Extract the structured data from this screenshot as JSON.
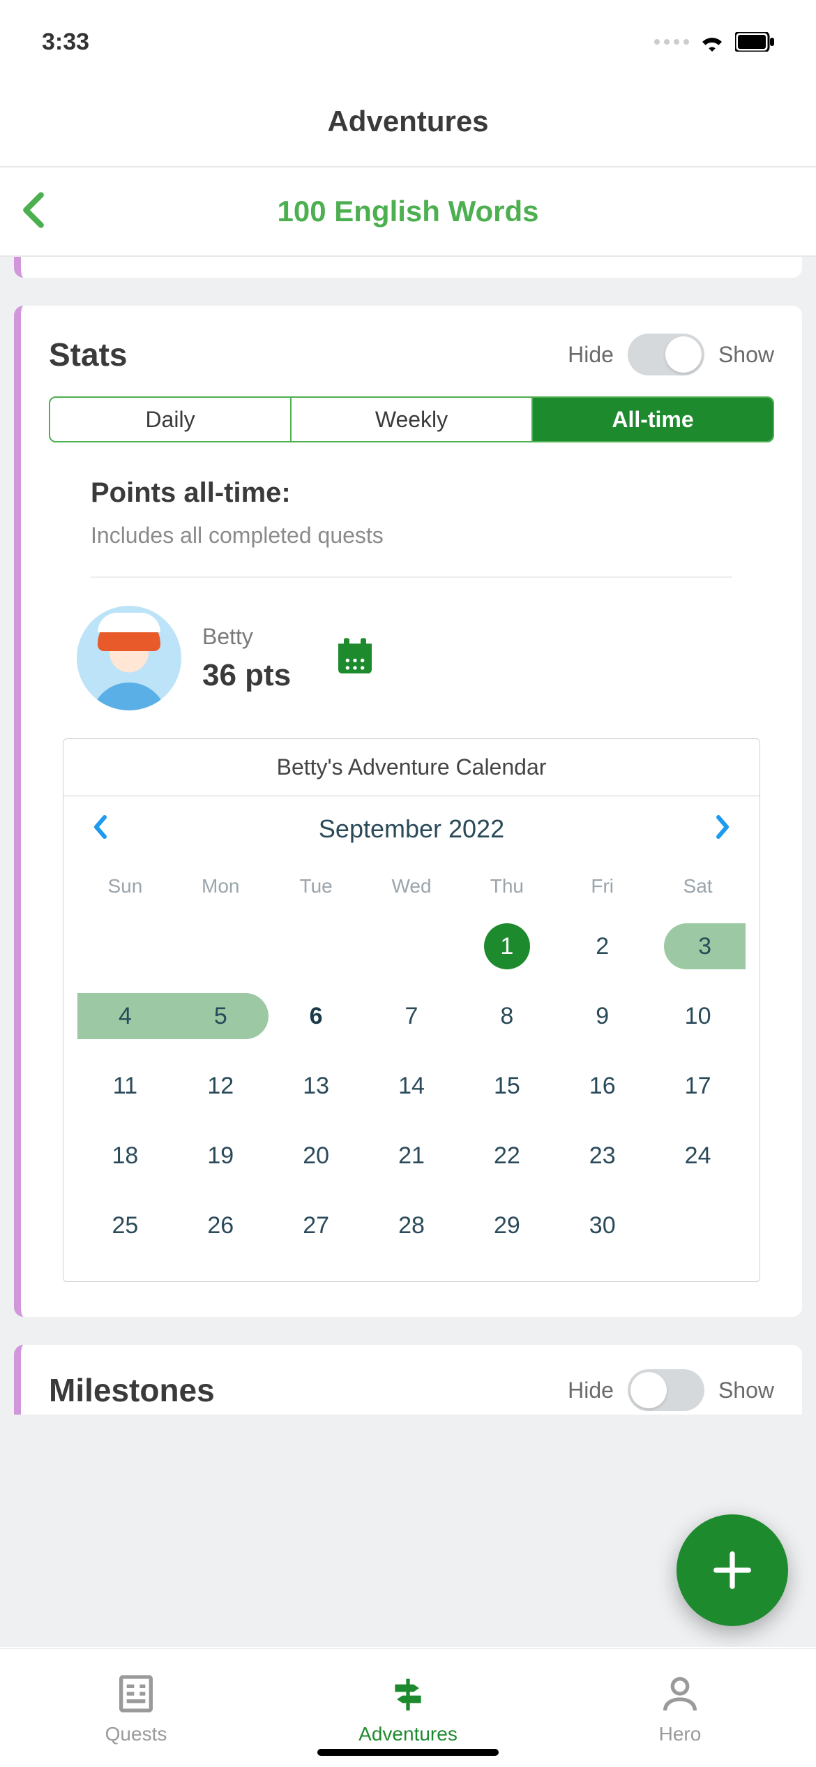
{
  "status": {
    "time": "3:33"
  },
  "header": {
    "title": "Adventures",
    "subtitle": "100 English Words"
  },
  "stats": {
    "title": "Stats",
    "hide": "Hide",
    "show": "Show",
    "tabs": [
      "Daily",
      "Weekly",
      "All-time"
    ],
    "active_tab": 2,
    "points_title": "Points all-time:",
    "points_sub": "Includes all completed quests",
    "user": {
      "name": "Betty",
      "points": "36 pts"
    },
    "calendar": {
      "title": "Betty's Adventure Calendar",
      "month": "September 2022",
      "dow": [
        "Sun",
        "Mon",
        "Tue",
        "Wed",
        "Thu",
        "Fri",
        "Sat"
      ],
      "weeks": [
        [
          null,
          null,
          null,
          null,
          {
            "n": 1,
            "circle": true
          },
          {
            "n": 2
          },
          {
            "n": 3,
            "pill": "start"
          }
        ],
        [
          {
            "n": 4,
            "pill": "mid"
          },
          {
            "n": 5,
            "pill": "end"
          },
          {
            "n": 6,
            "today": true
          },
          {
            "n": 7
          },
          {
            "n": 8
          },
          {
            "n": 9
          },
          {
            "n": 10
          }
        ],
        [
          {
            "n": 11
          },
          {
            "n": 12
          },
          {
            "n": 13
          },
          {
            "n": 14
          },
          {
            "n": 15
          },
          {
            "n": 16
          },
          {
            "n": 17
          }
        ],
        [
          {
            "n": 18
          },
          {
            "n": 19
          },
          {
            "n": 20
          },
          {
            "n": 21
          },
          {
            "n": 22
          },
          {
            "n": 23
          },
          {
            "n": 24
          }
        ],
        [
          {
            "n": 25
          },
          {
            "n": 26
          },
          {
            "n": 27
          },
          {
            "n": 28
          },
          {
            "n": 29
          },
          {
            "n": 30
          },
          null
        ]
      ]
    }
  },
  "milestones": {
    "title": "Milestones",
    "hide": "Hide",
    "show": "Show"
  },
  "tabs": {
    "quests": "Quests",
    "adventures": "Adventures",
    "hero": "Hero"
  }
}
